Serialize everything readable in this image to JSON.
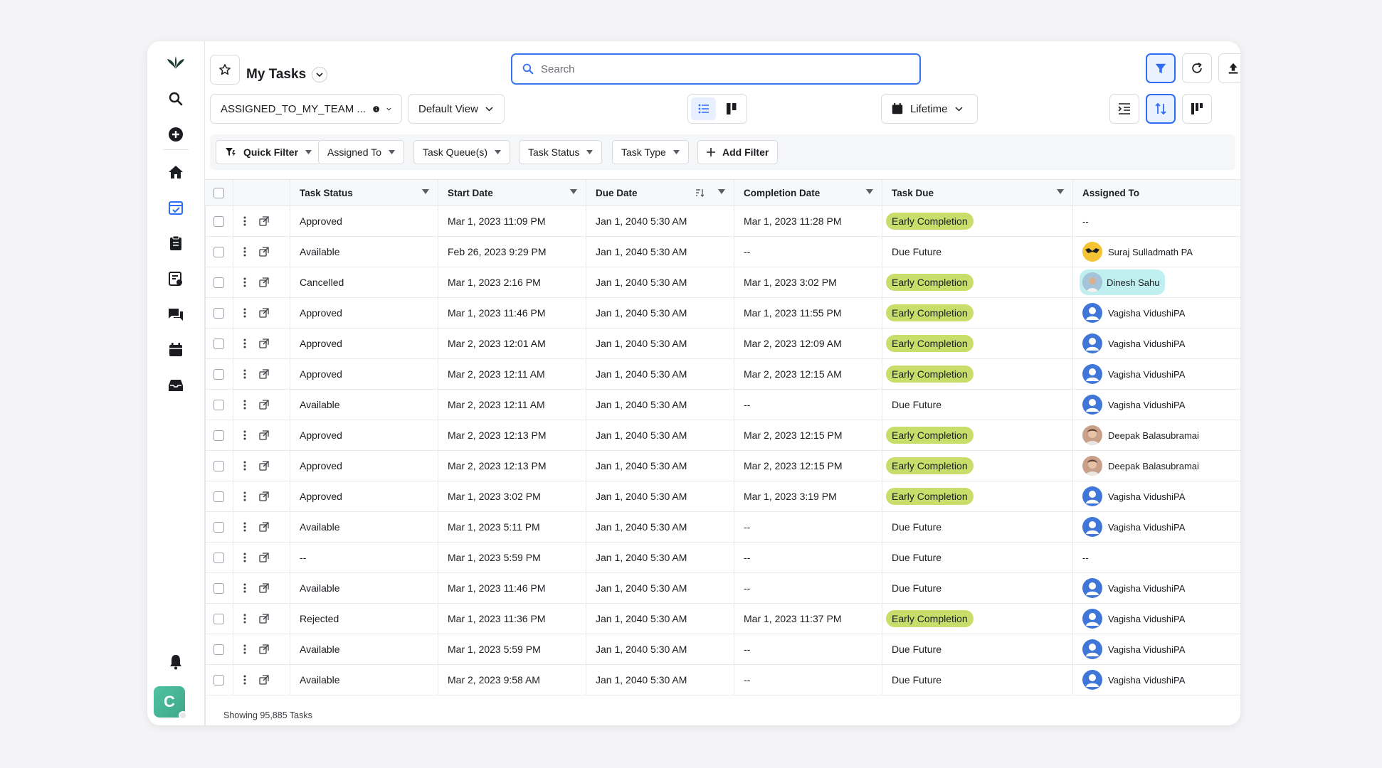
{
  "header": {
    "title": "My Tasks",
    "search_placeholder": "Search"
  },
  "toolbar": {
    "view_filter": "ASSIGNED_TO_MY_TEAM ...",
    "view": "Default View",
    "date_range": "Lifetime"
  },
  "filters": [
    {
      "label": "Quick Filter"
    },
    {
      "label": "Assigned To"
    },
    {
      "label": "Task Queue(s)"
    },
    {
      "label": "Task Status"
    },
    {
      "label": "Task Type"
    },
    {
      "label": "Add Filter"
    }
  ],
  "columns": [
    "Task Status",
    "Start Date",
    "Due Date",
    "Completion Date",
    "Task Due",
    "Assigned To"
  ],
  "rows": [
    {
      "status": "Approved",
      "start": "Mar 1, 2023 11:09 PM",
      "due": "Jan 1, 2040 5:30 AM",
      "completion": "Mar 1, 2023 11:28 PM",
      "task_due": "Early Completion",
      "badge": true,
      "assignee": "--",
      "avatar": "none"
    },
    {
      "status": "Available",
      "start": "Feb 26, 2023 9:29 PM",
      "due": "Jan 1, 2040 5:30 AM",
      "completion": "--",
      "task_due": "Due Future",
      "badge": false,
      "assignee": "Suraj Sulladmath PA",
      "avatar": "yellow"
    },
    {
      "status": "Cancelled",
      "start": "Mar 1, 2023 2:16 PM",
      "due": "Jan 1, 2040 5:30 AM",
      "completion": "Mar 1, 2023 3:02 PM",
      "task_due": "Early Completion",
      "badge": true,
      "assignee": "Dinesh Sahu",
      "avatar": "photo2",
      "highlight": true
    },
    {
      "status": "Approved",
      "start": "Mar 1, 2023 11:46 PM",
      "due": "Jan 1, 2040 5:30 AM",
      "completion": "Mar 1, 2023 11:55 PM",
      "task_due": "Early Completion",
      "badge": true,
      "assignee": "Vagisha VidushiPA",
      "avatar": "blue"
    },
    {
      "status": "Approved",
      "start": "Mar 2, 2023 12:01 AM",
      "due": "Jan 1, 2040 5:30 AM",
      "completion": "Mar 2, 2023 12:09 AM",
      "task_due": "Early Completion",
      "badge": true,
      "assignee": "Vagisha VidushiPA",
      "avatar": "blue"
    },
    {
      "status": "Approved",
      "start": "Mar 2, 2023 12:11 AM",
      "due": "Jan 1, 2040 5:30 AM",
      "completion": "Mar 2, 2023 12:15 AM",
      "task_due": "Early Completion",
      "badge": true,
      "assignee": "Vagisha VidushiPA",
      "avatar": "blue"
    },
    {
      "status": "Available",
      "start": "Mar 2, 2023 12:11 AM",
      "due": "Jan 1, 2040 5:30 AM",
      "completion": "--",
      "task_due": "Due Future",
      "badge": false,
      "assignee": "Vagisha VidushiPA",
      "avatar": "blue"
    },
    {
      "status": "Approved",
      "start": "Mar 2, 2023 12:13 PM",
      "due": "Jan 1, 2040 5:30 AM",
      "completion": "Mar 2, 2023 12:15 PM",
      "task_due": "Early Completion",
      "badge": true,
      "assignee": "Deepak Balasubramai",
      "avatar": "photo"
    },
    {
      "status": "Approved",
      "start": "Mar 2, 2023 12:13 PM",
      "due": "Jan 1, 2040 5:30 AM",
      "completion": "Mar 2, 2023 12:15 PM",
      "task_due": "Early Completion",
      "badge": true,
      "assignee": "Deepak Balasubramai",
      "avatar": "photo"
    },
    {
      "status": "Approved",
      "start": "Mar 1, 2023 3:02 PM",
      "due": "Jan 1, 2040 5:30 AM",
      "completion": "Mar 1, 2023 3:19 PM",
      "task_due": "Early Completion",
      "badge": true,
      "assignee": "Vagisha VidushiPA",
      "avatar": "blue"
    },
    {
      "status": "Available",
      "start": "Mar 1, 2023 5:11 PM",
      "due": "Jan 1, 2040 5:30 AM",
      "completion": "--",
      "task_due": "Due Future",
      "badge": false,
      "assignee": "Vagisha VidushiPA",
      "avatar": "blue"
    },
    {
      "status": "--",
      "start": "Mar 1, 2023 5:59 PM",
      "due": "Jan 1, 2040 5:30 AM",
      "completion": "--",
      "task_due": "Due Future",
      "badge": false,
      "assignee": "--",
      "avatar": "none"
    },
    {
      "status": "Available",
      "start": "Mar 1, 2023 11:46 PM",
      "due": "Jan 1, 2040 5:30 AM",
      "completion": "--",
      "task_due": "Due Future",
      "badge": false,
      "assignee": "Vagisha VidushiPA",
      "avatar": "blue"
    },
    {
      "status": "Rejected",
      "start": "Mar 1, 2023 11:36 PM",
      "due": "Jan 1, 2040 5:30 AM",
      "completion": "Mar 1, 2023 11:37 PM",
      "task_due": "Early Completion",
      "badge": true,
      "assignee": "Vagisha VidushiPA",
      "avatar": "blue"
    },
    {
      "status": "Available",
      "start": "Mar 1, 2023 5:59 PM",
      "due": "Jan 1, 2040 5:30 AM",
      "completion": "--",
      "task_due": "Due Future",
      "badge": false,
      "assignee": "Vagisha VidushiPA",
      "avatar": "blue"
    },
    {
      "status": "Available",
      "start": "Mar 2, 2023 9:58 AM",
      "due": "Jan 1, 2040 5:30 AM",
      "completion": "--",
      "task_due": "Due Future",
      "badge": false,
      "assignee": "Vagisha VidushiPA",
      "avatar": "blue"
    }
  ],
  "footer": {
    "text": "Showing 95,885 Tasks"
  },
  "user": {
    "initial": "C"
  },
  "nav": [
    "logo-icon",
    "search-icon",
    "add-icon",
    "home-icon",
    "tasks-icon",
    "clipboard-icon",
    "reports-icon",
    "chat-icon",
    "calendar-icon",
    "inbox-icon",
    "bell-icon"
  ],
  "colors": {
    "accent": "#2f6df6",
    "badge": "#c8dd6a",
    "highlight": "#bff0ef",
    "avatar_blue": "#3f76d8"
  }
}
